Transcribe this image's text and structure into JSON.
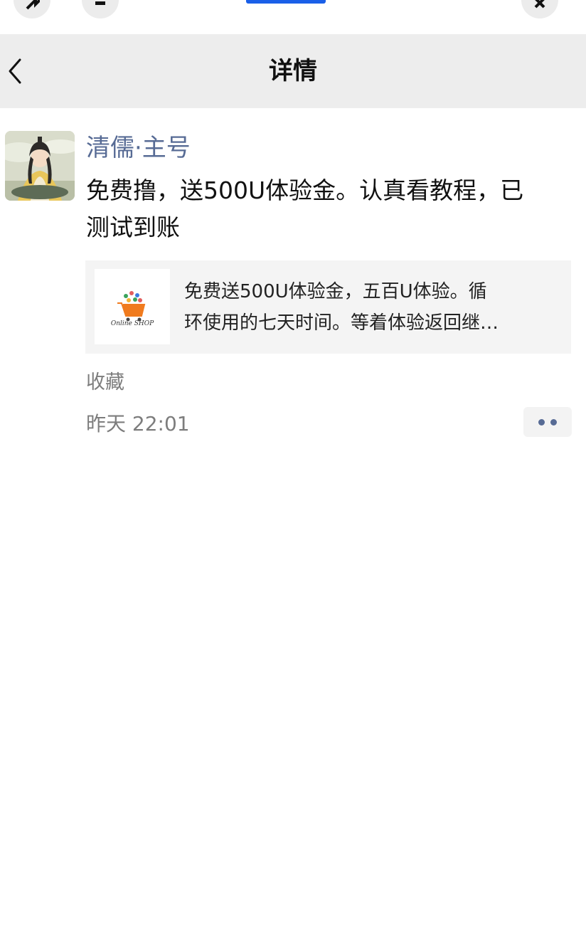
{
  "top_bar": {
    "icons": [
      "cast-icon",
      "minimize-icon",
      "close-icon"
    ]
  },
  "nav": {
    "back_icon": "chevron-left-icon",
    "title": "详情"
  },
  "post": {
    "author": "清儒·主号",
    "text_line1": "免费撸，送500U体验金。认真看教程，已",
    "text_line2": "测试到账",
    "link_card": {
      "thumbnail_text": "Online SHOP",
      "line1": "免费送500U体验金，五百U体验。循",
      "line2": "环使用的七天时间。等着体验返回继…"
    },
    "favorite_label": "收藏",
    "timestamp": "昨天 22:01",
    "more_icon": "more-dots-icon"
  },
  "colors": {
    "nav_bg": "#ededed",
    "name_link": "#576b95",
    "accent_line": "#1a5fe8",
    "card_bg": "#f4f4f4",
    "meta_text": "#7d7d7d"
  }
}
